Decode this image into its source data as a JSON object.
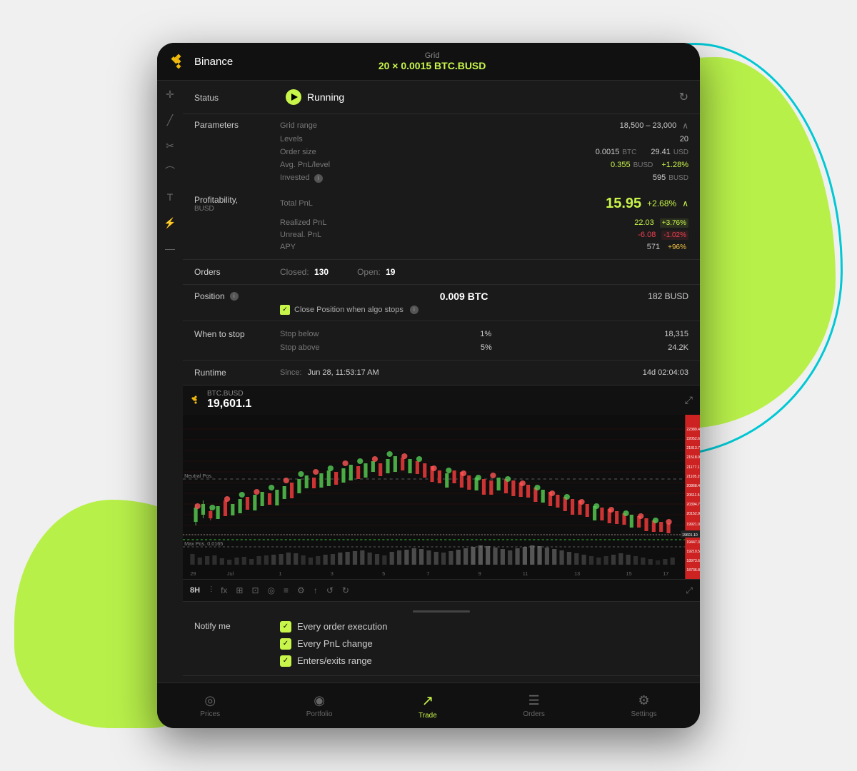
{
  "background": {
    "blob_color": "#b8f04a",
    "outline_color": "#00c8d4"
  },
  "header": {
    "exchange": "Binance",
    "grid_label": "Grid",
    "pair": "20 × 0.0015 BTC.BUSD"
  },
  "status": {
    "label": "Status",
    "value": "Running",
    "refresh_icon": "↻"
  },
  "parameters": {
    "label": "Parameters",
    "grid_range_label": "Grid range",
    "grid_range_value": "18,500 – 23,000",
    "levels_label": "Levels",
    "levels_value": "20",
    "order_size_label": "Order size",
    "order_size_value": "0.0015",
    "order_size_unit": "BTC",
    "order_size_usd": "29.41",
    "order_size_usd_unit": "USD",
    "avg_pnl_label": "Avg. PnL/level",
    "avg_pnl_value": "0.355",
    "avg_pnl_unit": "BUSD",
    "avg_pnl_pct": "+1.28%",
    "invested_label": "Invested",
    "invested_value": "595",
    "invested_unit": "BUSD"
  },
  "profitability": {
    "label": "Profitability,",
    "unit": "BUSD",
    "total_pnl_label": "Total PnL",
    "total_pnl_value": "15.95",
    "total_pnl_pct": "+2.68%",
    "realized_label": "Realized PnL",
    "realized_value": "22.03",
    "realized_pct": "+3.76%",
    "unrealized_label": "Unreal. PnL",
    "unrealized_value": "-6.08",
    "unrealized_pct": "-1.02%",
    "apy_label": "APY",
    "apy_value": "571",
    "apy_pct": "+96%"
  },
  "orders": {
    "label": "Orders",
    "closed_label": "Closed:",
    "closed_value": "130",
    "open_label": "Open:",
    "open_value": "19"
  },
  "position": {
    "label": "Position",
    "btc_value": "0.009 BTC",
    "busd_value": "182 BUSD",
    "close_position_text": "Close Position when algo stops"
  },
  "when_to_stop": {
    "label": "When to stop",
    "stop_below_label": "Stop below",
    "stop_below_pct": "1%",
    "stop_below_value": "18,315",
    "stop_above_label": "Stop above",
    "stop_above_pct": "5%",
    "stop_above_value": "24.2K"
  },
  "runtime": {
    "label": "Runtime",
    "since_label": "Since:",
    "since_value": "Jun 28, 11:53:17 AM",
    "elapsed": "14d 02:04:03"
  },
  "chart": {
    "pair": "BTC.BUSD",
    "price": "19,601.1",
    "expand_icon": "⤢",
    "timeframe": "8H",
    "price_levels": [
      "22389.47",
      "22052.63",
      "21813.79",
      "21518.99",
      "21177.17",
      "21105.26",
      "20868.42",
      "20611.58",
      "20394.74",
      "20152.99",
      "19921.05",
      "19601.10",
      "19447.37",
      "19210.53",
      "18973.68",
      "18736.84"
    ]
  },
  "notify": {
    "label": "Notify me",
    "items": [
      {
        "text": "Every order execution",
        "checked": true
      },
      {
        "text": "Every PnL change",
        "checked": true
      },
      {
        "text": "Enters/exits range",
        "checked": true
      }
    ]
  },
  "bottom_nav": {
    "items": [
      {
        "label": "Prices",
        "icon": "◎",
        "active": false
      },
      {
        "label": "Portfolio",
        "icon": "◉",
        "active": false
      },
      {
        "label": "Trade",
        "icon": "↗",
        "active": true
      },
      {
        "label": "Orders",
        "icon": "☰",
        "active": false
      },
      {
        "label": "Settings",
        "icon": "⚙",
        "active": false
      }
    ]
  }
}
